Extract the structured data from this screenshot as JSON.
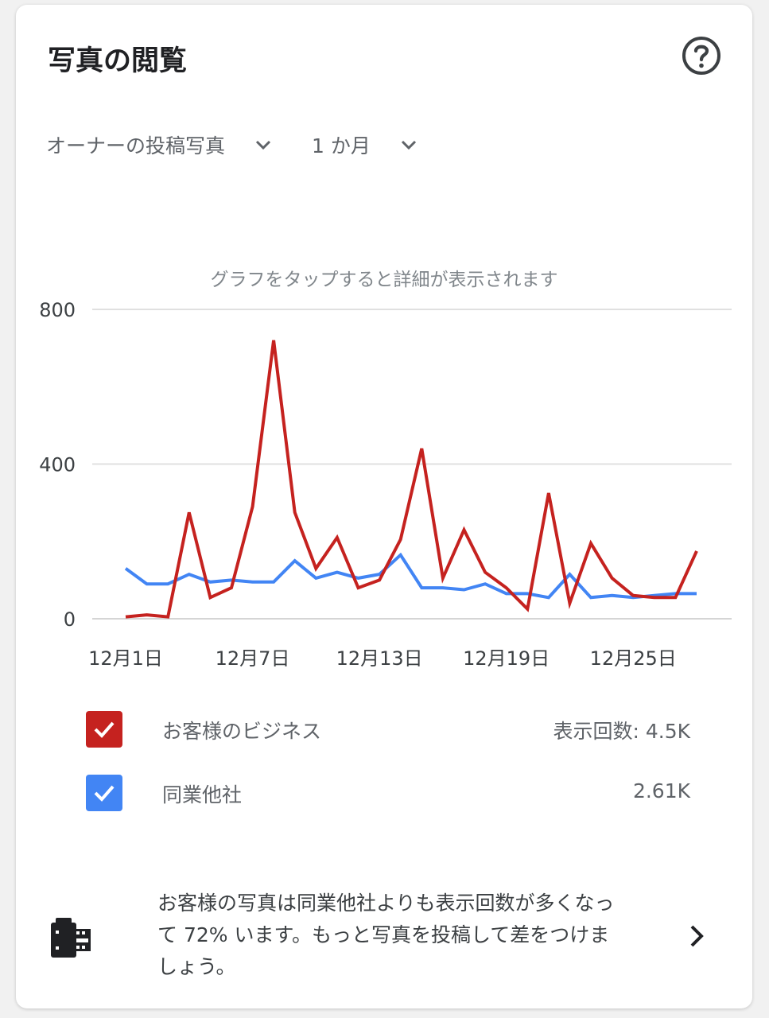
{
  "header": {
    "title": "写真の閲覧"
  },
  "filters": {
    "photo_type": "オーナーの投稿写真",
    "period": "1 か月"
  },
  "chart_hint": "グラフをタップすると詳細が表示されます",
  "legend": [
    {
      "label": "お客様のビジネス",
      "value": "表示回数: 4.5K",
      "color": "#c5221f"
    },
    {
      "label": "同業他社",
      "value": "2.61K",
      "color": "#4285f4"
    }
  ],
  "footer": {
    "message": "お客様の写真は同業他社よりも表示回数が多くなって 72% います。もっと写真を投稿して差をつけましょう。"
  },
  "chart_data": {
    "type": "line",
    "title": "",
    "xlabel": "",
    "ylabel": "",
    "ylim": [
      0,
      800
    ],
    "yticks": [
      0,
      400,
      800
    ],
    "x": [
      1,
      2,
      3,
      4,
      5,
      6,
      7,
      8,
      9,
      10,
      11,
      12,
      13,
      14,
      15,
      16,
      17,
      18,
      19,
      20,
      21,
      22,
      23,
      24,
      25,
      26,
      27,
      28
    ],
    "xticks": [
      {
        "x": 1,
        "label": "12月1日"
      },
      {
        "x": 7,
        "label": "12月7日"
      },
      {
        "x": 13,
        "label": "12月13日"
      },
      {
        "x": 19,
        "label": "12月19日"
      },
      {
        "x": 25,
        "label": "12月25日"
      }
    ],
    "grid": true,
    "series": [
      {
        "name": "お客様のビジネス",
        "color": "#c5221f",
        "values": [
          5,
          10,
          5,
          275,
          55,
          80,
          290,
          720,
          275,
          130,
          210,
          80,
          100,
          205,
          440,
          105,
          230,
          120,
          80,
          25,
          325,
          40,
          195,
          105,
          60,
          55,
          55,
          175
        ]
      },
      {
        "name": "同業他社",
        "color": "#4285f4",
        "values": [
          130,
          90,
          90,
          115,
          95,
          100,
          95,
          95,
          150,
          105,
          120,
          105,
          115,
          165,
          80,
          80,
          75,
          90,
          65,
          65,
          55,
          115,
          55,
          60,
          55,
          60,
          65,
          65
        ]
      }
    ]
  }
}
